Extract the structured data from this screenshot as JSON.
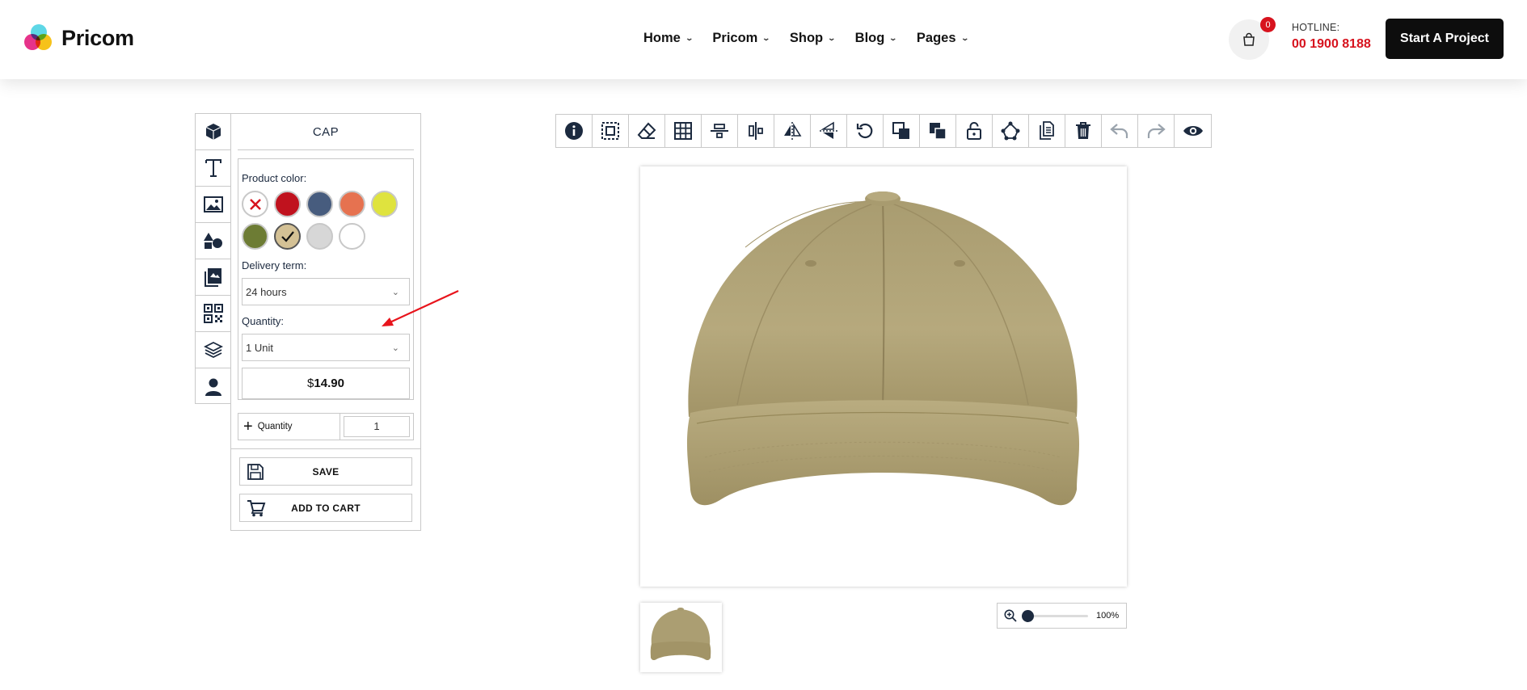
{
  "brand": {
    "name": "Pricom"
  },
  "nav": {
    "items": [
      {
        "label": "Home"
      },
      {
        "label": "Pricom"
      },
      {
        "label": "Shop"
      },
      {
        "label": "Blog"
      },
      {
        "label": "Pages"
      }
    ]
  },
  "cart": {
    "count": "0",
    "icon": "shopping-bag-icon"
  },
  "hotline": {
    "label": "HOTLINE:",
    "number": "00 1900 8188"
  },
  "cta": {
    "label": "Start A Project"
  },
  "colors": {
    "accent_red": "#d7131e",
    "dark": "#1c2a3f",
    "cap": "#b5a87c"
  },
  "side_tabs": [
    "product-icon",
    "text-icon",
    "image-icon",
    "shapes-icon",
    "templates-icon",
    "qr-code-icon",
    "layers-icon",
    "user-icon"
  ],
  "panel": {
    "title": "CAP",
    "product_color_label": "Product color:",
    "swatches": [
      {
        "name": "none",
        "color": "#ffffff"
      },
      {
        "name": "red",
        "color": "#c0121e"
      },
      {
        "name": "slate-blue",
        "color": "#475c7e"
      },
      {
        "name": "orange",
        "color": "#e67250"
      },
      {
        "name": "lime",
        "color": "#dfe33e"
      },
      {
        "name": "olive",
        "color": "#6d7c34"
      },
      {
        "name": "tan",
        "color": "#d4c195",
        "selected": true
      },
      {
        "name": "light-gray",
        "color": "#d7d7d7"
      },
      {
        "name": "white",
        "color": "#ffffff"
      }
    ],
    "delivery_label": "Delivery term:",
    "delivery_value": "24 hours",
    "quantity_label": "Quantity:",
    "quantity_value": "1 Unit",
    "price_symbol": "$",
    "price_value": "14.90",
    "qty_row_label": "Quantity",
    "qty_row_value": "1",
    "save_label": "SAVE",
    "add_to_cart_label": "ADD TO CART"
  },
  "toolbar": [
    "info-icon",
    "select-icon",
    "eraser-icon",
    "grid-icon",
    "align-center-horizontal-icon",
    "align-center-vertical-icon",
    "flip-horizontal-icon",
    "flip-vertical-icon",
    "rotate-icon",
    "bring-forward-icon",
    "send-backward-icon",
    "lock-icon",
    "group-icon",
    "duplicate-icon",
    "delete-icon",
    "undo-icon",
    "redo-icon",
    "preview-icon"
  ],
  "zoom": {
    "value": "100%",
    "level": 0.0
  }
}
